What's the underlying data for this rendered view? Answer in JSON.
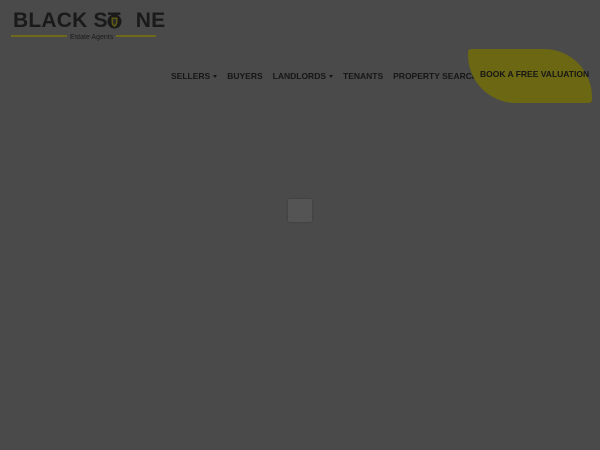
{
  "brand": {
    "name_part1": "BLACK ST",
    "name_part2": "NE",
    "tagline": "Estate Agents",
    "logo_icon": "shield-crest-icon"
  },
  "nav": {
    "items": [
      {
        "label": "SELLERS",
        "has_dropdown": true
      },
      {
        "label": "BUYERS",
        "has_dropdown": false
      },
      {
        "label": "LANDLORDS",
        "has_dropdown": true
      },
      {
        "label": "TENANTS",
        "has_dropdown": false
      },
      {
        "label": "PROPERTY SEARCH",
        "has_dropdown": true
      }
    ],
    "cta_label": "BOOK A FREE VALUATION"
  },
  "colors": {
    "background": "#4a4a4a",
    "accent": "#6b6713",
    "text": "#161616"
  }
}
